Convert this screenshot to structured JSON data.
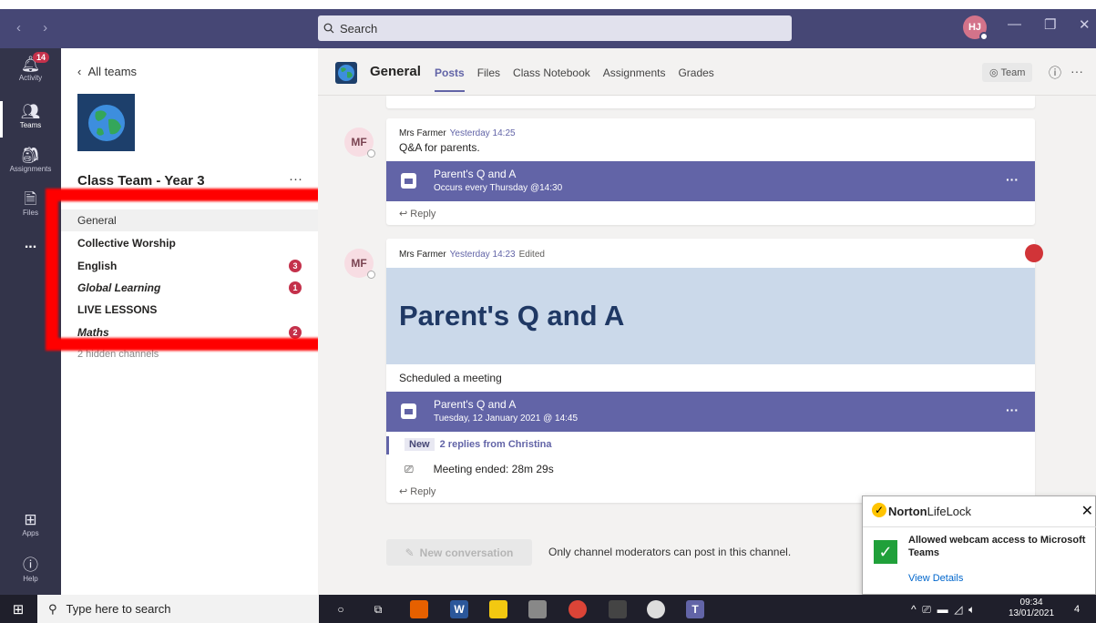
{
  "titlebar": {
    "nav_arrows": "‹ ›",
    "search_placeholder": "Search",
    "user_initials": "HJ"
  },
  "rail": {
    "activity_label": "Activity",
    "activity_badge": "14",
    "teams_label": "Teams",
    "assignments_label": "Assignments",
    "files_label": "Files",
    "more_label": "...",
    "apps_label": "Apps",
    "help_label": "Help"
  },
  "left_panel": {
    "all_teams": "All teams",
    "team_name": "Class Team - Year 3",
    "more": "···",
    "channels": [
      {
        "label": "General",
        "badge": ""
      },
      {
        "label": "Collective Worship",
        "badge": ""
      },
      {
        "label": "English",
        "badge": "3"
      },
      {
        "label": "Global Learning",
        "badge": "1"
      },
      {
        "label": "LIVE LESSONS",
        "badge": ""
      },
      {
        "label": "Maths",
        "badge": "2"
      }
    ],
    "hidden_channels": "2 hidden channels"
  },
  "header": {
    "channel_title": "General",
    "tabs": [
      "Posts",
      "Files",
      "Class Notebook",
      "Assignments",
      "Grades"
    ],
    "team_button": "Team"
  },
  "messages": [
    {
      "avatar": "MF",
      "author": "Mrs Farmer",
      "time": "Yesterday 14:25",
      "edited": "",
      "body": "Q&A for parents.",
      "meeting_title": "Parent's Q and A",
      "meeting_sub": "Occurs every Thursday @14:30",
      "reply": "Reply"
    },
    {
      "avatar": "MF",
      "author": "Mrs Farmer",
      "time": "Yesterday 14:23",
      "edited": "Edited",
      "banner_title": "Parent's Q and A",
      "body": "Scheduled a meeting",
      "meeting_title": "Parent's Q and A",
      "meeting_sub": "Tuesday, 12 January 2021 @ 14:45",
      "new_label": "New",
      "replies": "2 replies from Christina",
      "meeting_ended": "Meeting ended: 28m 29s",
      "reply": "Reply"
    }
  ],
  "compose": {
    "new_conversation": "New conversation",
    "moderators_note": "Only channel moderators can post in this channel."
  },
  "norton": {
    "brand_a": "Norton",
    "brand_b": "LifeLock",
    "message": "Allowed webcam access to Microsoft Teams",
    "link": "View Details"
  },
  "taskbar": {
    "search_placeholder": "Type here to search",
    "time": "09:34",
    "date": "13/01/2021",
    "notif_count": "4"
  },
  "colors": {
    "teams_purple": "#6264a7",
    "titlebar": "#464775",
    "rail": "#33344a",
    "badge_red": "#c4314b",
    "annotation_red": "#ff0000"
  }
}
